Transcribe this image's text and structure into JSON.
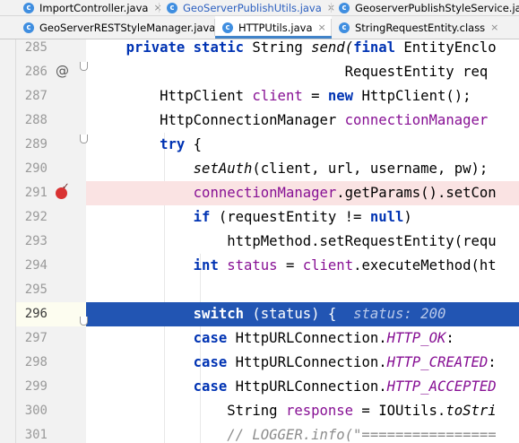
{
  "tabs_row1": [
    {
      "label": "ImportController.java",
      "icon": "class-icon",
      "close": "×",
      "style": "normal"
    },
    {
      "label": "GeoServerPublishUtils.java",
      "icon": "class-icon",
      "close": "×",
      "style": "blue"
    },
    {
      "label": "GeoserverPublishStyleService.java",
      "icon": "class-icon",
      "close": "×",
      "style": "normal"
    }
  ],
  "tabs_row2": [
    {
      "label": "GeoServerRESTStyleManager.java",
      "icon": "class-icon",
      "close": "×",
      "style": "normal"
    },
    {
      "label": "HTTPUtils.java",
      "icon": "class-icon",
      "close": "×",
      "style": "active"
    },
    {
      "label": "StringRequestEntity.class",
      "icon": "class-icon",
      "close": "×",
      "style": "normal"
    }
  ],
  "icon_letter": "c",
  "editor": {
    "highlight_colors": {
      "current_line": "#2255b3",
      "breakpoint_line": "#fae3e3"
    },
    "lines": [
      {
        "num": "285",
        "tokens": [
          {
            "t": "    "
          },
          {
            "t": "private static",
            "c": "kw"
          },
          {
            "t": " String "
          },
          {
            "t": "send(",
            "c": "mth"
          },
          {
            "t": "final",
            "c": "kw"
          },
          {
            "t": " EntityEnclo"
          }
        ]
      },
      {
        "num": "286",
        "tokens": [
          {
            "t": "                              RequestEntity req"
          }
        ]
      },
      {
        "num": "287",
        "tokens": [
          {
            "t": "        HttpClient "
          },
          {
            "t": "client",
            "c": "fld"
          },
          {
            "t": " = "
          },
          {
            "t": "new",
            "c": "kw"
          },
          {
            "t": " HttpClient();"
          }
        ]
      },
      {
        "num": "288",
        "tokens": [
          {
            "t": "        HttpConnectionManager "
          },
          {
            "t": "connectionManager",
            "c": "fld"
          }
        ]
      },
      {
        "num": "289",
        "tokens": [
          {
            "t": "        "
          },
          {
            "t": "try",
            "c": "kw"
          },
          {
            "t": " {"
          }
        ]
      },
      {
        "num": "290",
        "tokens": [
          {
            "t": "            "
          },
          {
            "t": "setAuth",
            "c": "mth"
          },
          {
            "t": "(client, url, username, pw);"
          }
        ]
      },
      {
        "num": "291",
        "tokens": [
          {
            "t": "            "
          },
          {
            "t": "connectionManager",
            "c": "fld"
          },
          {
            "t": ".getParams().setCon"
          }
        ]
      },
      {
        "num": "292",
        "tokens": [
          {
            "t": "            "
          },
          {
            "t": "if",
            "c": "kw"
          },
          {
            "t": " (requestEntity != "
          },
          {
            "t": "null",
            "c": "kw"
          },
          {
            "t": ")"
          }
        ]
      },
      {
        "num": "293",
        "tokens": [
          {
            "t": "                httpMethod.setRequestEntity(requ"
          }
        ]
      },
      {
        "num": "294",
        "tokens": [
          {
            "t": "            "
          },
          {
            "t": "int",
            "c": "kw"
          },
          {
            "t": " "
          },
          {
            "t": "status",
            "c": "fld"
          },
          {
            "t": " = "
          },
          {
            "t": "client",
            "c": "fld"
          },
          {
            "t": ".executeMethod(ht"
          }
        ]
      },
      {
        "num": "295",
        "tokens": []
      },
      {
        "num": "296",
        "tokens": [
          {
            "t": "            "
          },
          {
            "t": "switch",
            "c": "kw"
          },
          {
            "t": " (status) {  "
          },
          {
            "t": "status: 200",
            "c": "hint"
          }
        ]
      },
      {
        "num": "297",
        "tokens": [
          {
            "t": "            "
          },
          {
            "t": "case",
            "c": "kw"
          },
          {
            "t": " HttpURLConnection."
          },
          {
            "t": "HTTP_OK",
            "c": "cst"
          },
          {
            "t": ":"
          }
        ]
      },
      {
        "num": "298",
        "tokens": [
          {
            "t": "            "
          },
          {
            "t": "case",
            "c": "kw"
          },
          {
            "t": " HttpURLConnection."
          },
          {
            "t": "HTTP_CREATED",
            "c": "cst"
          },
          {
            "t": ":"
          }
        ]
      },
      {
        "num": "299",
        "tokens": [
          {
            "t": "            "
          },
          {
            "t": "case",
            "c": "kw"
          },
          {
            "t": " HttpURLConnection."
          },
          {
            "t": "HTTP_ACCEPTED",
            "c": "cst"
          }
        ]
      },
      {
        "num": "300",
        "tokens": [
          {
            "t": "                String "
          },
          {
            "t": "response",
            "c": "fld"
          },
          {
            "t": " = IOUtils."
          },
          {
            "t": "toStri",
            "c": "mth"
          }
        ]
      },
      {
        "num": "301",
        "tokens": [
          {
            "t": "                "
          },
          {
            "t": "// LOGGER.info(\"================",
            "c": "cmt"
          }
        ]
      }
    ],
    "current_line": "296",
    "breakpoint_line": "291",
    "override_marker_line": "286",
    "override_marker": "@"
  }
}
